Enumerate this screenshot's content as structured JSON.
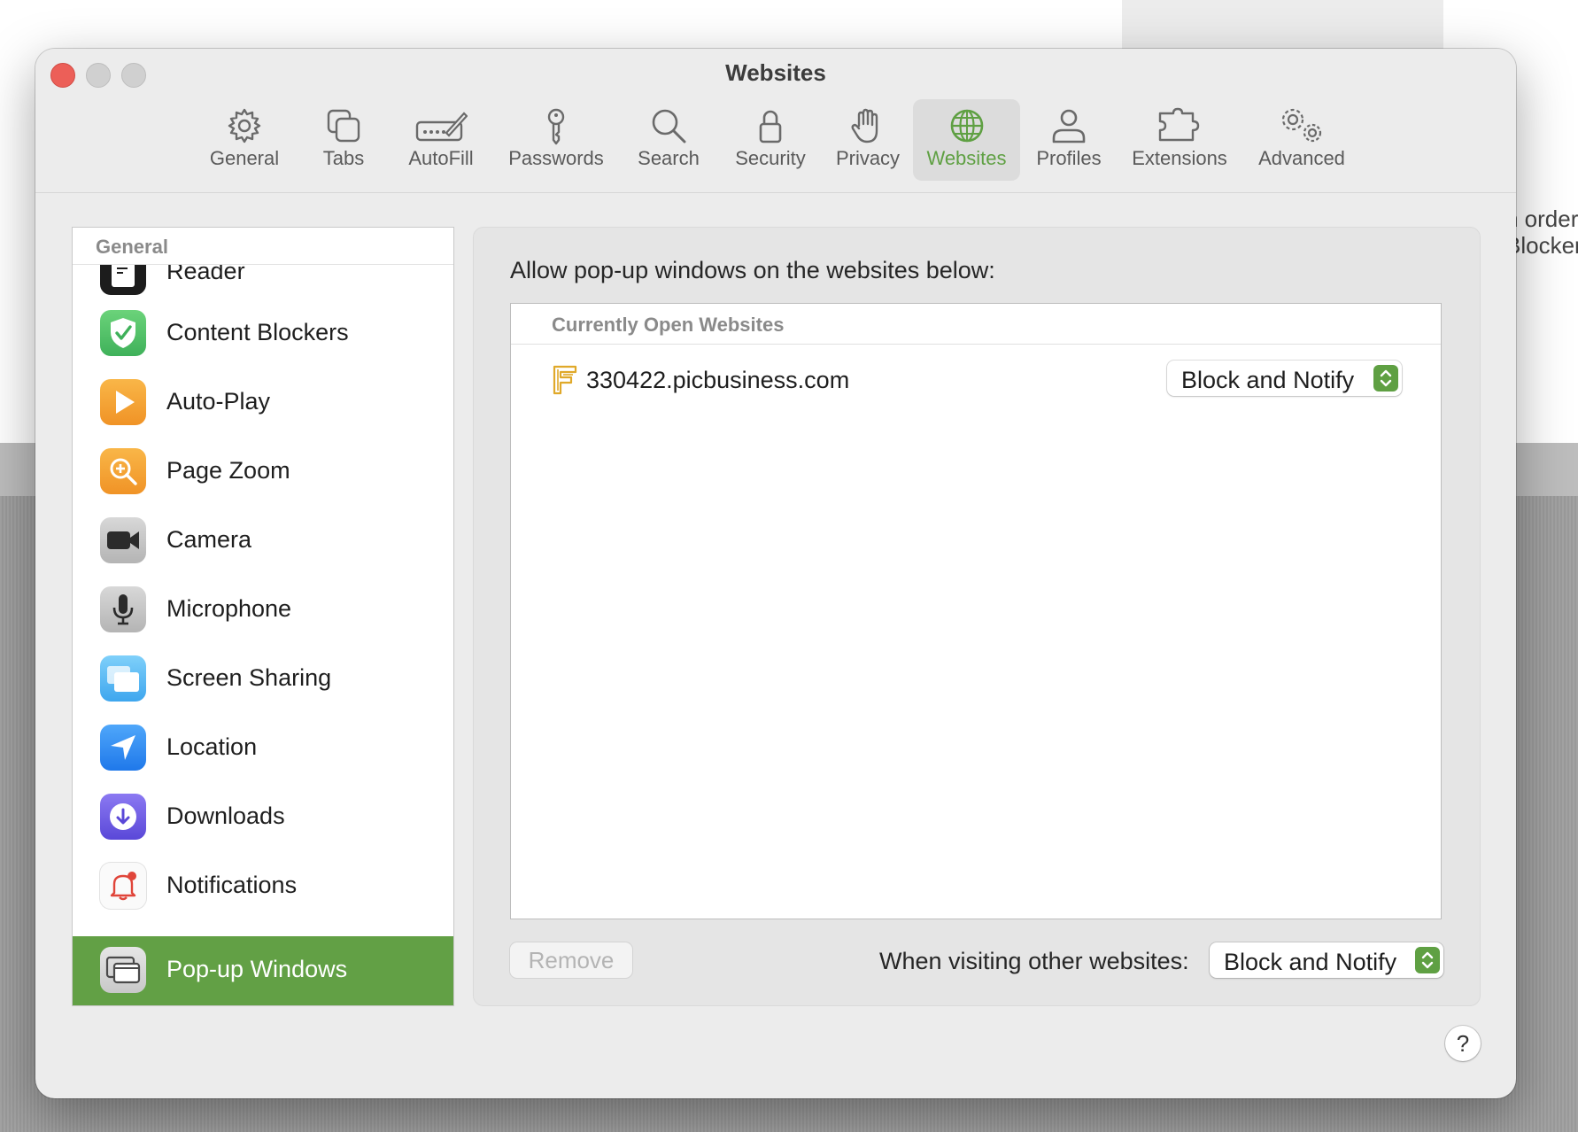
{
  "background": {
    "right_text_line1": "n order",
    "right_text_line2": "Blocker"
  },
  "window": {
    "title": "Websites"
  },
  "toolbar": {
    "items": [
      {
        "label": "General",
        "icon": "gear-icon"
      },
      {
        "label": "Tabs",
        "icon": "tabs-icon"
      },
      {
        "label": "AutoFill",
        "icon": "autofill-pen-icon"
      },
      {
        "label": "Passwords",
        "icon": "key-icon"
      },
      {
        "label": "Search",
        "icon": "magnifier-icon"
      },
      {
        "label": "Security",
        "icon": "lock-icon"
      },
      {
        "label": "Privacy",
        "icon": "hand-icon"
      },
      {
        "label": "Websites",
        "icon": "globe-icon",
        "selected": true
      },
      {
        "label": "Profiles",
        "icon": "person-icon"
      },
      {
        "label": "Extensions",
        "icon": "puzzle-icon"
      },
      {
        "label": "Advanced",
        "icon": "gears-icon"
      }
    ],
    "accent_color": "#5fa043"
  },
  "sidebar": {
    "section_header": "General",
    "items": [
      {
        "label": "Reader",
        "icon": "reader-icon"
      },
      {
        "label": "Content Blockers",
        "icon": "shield-check-icon"
      },
      {
        "label": "Auto-Play",
        "icon": "play-icon"
      },
      {
        "label": "Page Zoom",
        "icon": "zoom-icon"
      },
      {
        "label": "Camera",
        "icon": "camera-icon"
      },
      {
        "label": "Microphone",
        "icon": "microphone-icon"
      },
      {
        "label": "Screen Sharing",
        "icon": "screen-sharing-icon"
      },
      {
        "label": "Location",
        "icon": "location-arrow-icon"
      },
      {
        "label": "Downloads",
        "icon": "download-icon"
      },
      {
        "label": "Notifications",
        "icon": "bell-icon"
      },
      {
        "label": "Pop-up Windows",
        "icon": "popup-window-icon",
        "selected": true
      }
    ],
    "selected_color": "#62a045"
  },
  "content": {
    "allow_label": "Allow pop-up windows on the websites below:",
    "list_header": "Currently Open Websites",
    "sites": [
      {
        "name": "330422.picbusiness.com",
        "setting": "Block and Notify"
      }
    ],
    "remove_button": "Remove",
    "other_label": "When visiting other websites:",
    "other_setting": "Block and Notify",
    "help_button": "?"
  }
}
